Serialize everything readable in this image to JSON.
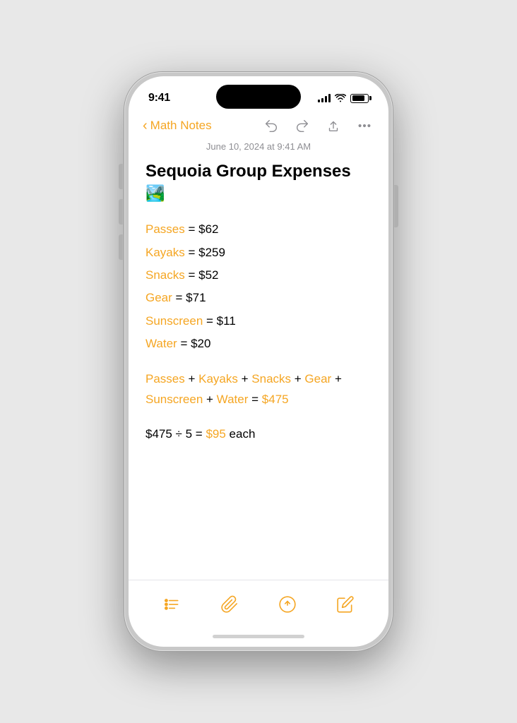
{
  "status_bar": {
    "time": "9:41"
  },
  "nav": {
    "back_label": "Math Notes",
    "undo_icon": "undo-icon",
    "redo_icon": "redo-icon",
    "share_icon": "share-icon",
    "more_icon": "more-icon"
  },
  "note": {
    "date": "June 10, 2024 at 9:41 AM",
    "title": "Sequoia Group Expenses",
    "emoji": "🏞️",
    "expenses": [
      {
        "var": "Passes",
        "value": "= $62"
      },
      {
        "var": "Kayaks",
        "value": "= $259"
      },
      {
        "var": "Snacks",
        "value": "= $52"
      },
      {
        "var": "Gear",
        "value": "= $71"
      },
      {
        "var": "Sunscreen",
        "value": "= $11"
      },
      {
        "var": "Water",
        "value": "= $20"
      }
    ],
    "formula_line1_parts": [
      {
        "text": "Passes",
        "type": "var"
      },
      {
        "text": " + ",
        "type": "op"
      },
      {
        "text": "Kayaks",
        "type": "var"
      },
      {
        "text": " + ",
        "type": "op"
      },
      {
        "text": "Snacks",
        "type": "var"
      },
      {
        "text": " + ",
        "type": "op"
      },
      {
        "text": "Gear",
        "type": "var"
      },
      {
        "text": " +",
        "type": "op"
      }
    ],
    "formula_line2_parts": [
      {
        "text": "Sunscreen",
        "type": "var"
      },
      {
        "text": " + ",
        "type": "op"
      },
      {
        "text": "Water",
        "type": "var"
      },
      {
        "text": " = ",
        "type": "op"
      },
      {
        "text": "$475",
        "type": "result"
      }
    ],
    "division_text_prefix": "$475 ÷ 5 = ",
    "division_result": "$95",
    "division_text_suffix": " each"
  },
  "toolbar": {
    "checklist_label": "checklist",
    "attach_label": "attach",
    "send_label": "send",
    "compose_label": "compose"
  }
}
